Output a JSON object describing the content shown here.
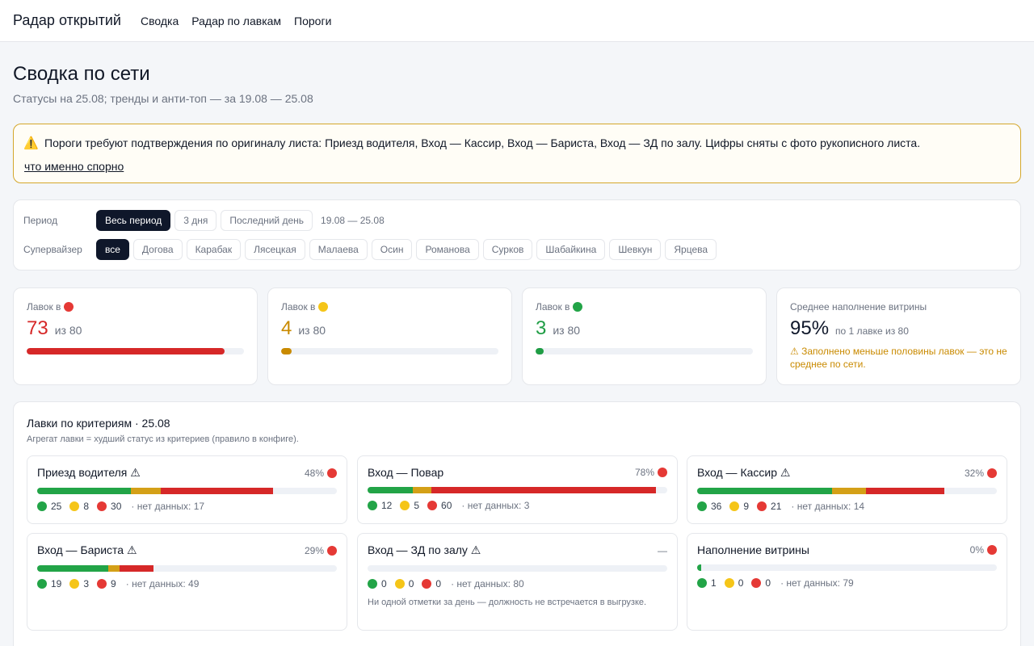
{
  "header": {
    "brand": "Радар открытий",
    "nav": [
      "Сводка",
      "Радар по лавкам",
      "Пороги"
    ]
  },
  "page": {
    "title": "Сводка по сети",
    "subtitle": "Статусы на 25.08; тренды и анти-топ — за 19.08 — 25.08"
  },
  "warning": {
    "icon": "warning-icon",
    "text": "Пороги требуют подтверждения по оригиналу листа: Приезд водителя, Вход — Кассир, Вход — Бариста, Вход — ЗД по залу. Цифры сняты с фото рукописного листа.",
    "link": "что именно спорно"
  },
  "filters": {
    "period_label": "Период",
    "period_options": [
      "Весь период",
      "3 дня",
      "Последний день"
    ],
    "period_selected": "Весь период",
    "period_range": "19.08 — 25.08",
    "supervisor_label": "Супервайзер",
    "supervisor_options": [
      "все",
      "Догова",
      "Карабак",
      "Лясецкая",
      "Малаева",
      "Осин",
      "Романова",
      "Сурков",
      "Шабайкина",
      "Шевкун",
      "Ярцева"
    ],
    "supervisor_selected": "все"
  },
  "kpis": {
    "red": {
      "label": "Лавок в",
      "value": "73",
      "of": "из 80",
      "fraction": 0.9125,
      "color": "#d62828"
    },
    "yellow": {
      "label": "Лавок в",
      "value": "4",
      "of": "из 80",
      "fraction": 0.05,
      "color": "#c98a00"
    },
    "green": {
      "label": "Лавок в",
      "value": "3",
      "of": "из 80",
      "fraction": 0.0375,
      "color": "#1f9d45"
    },
    "fill": {
      "label": "Среднее наполнение витрины",
      "value": "95%",
      "sub": "по 1 лавке из 80",
      "note": "⚠ Заполнено меньше половины лавок — это не среднее по сети."
    }
  },
  "criteria": {
    "title": "Лавки по критериям · 25.08",
    "subtitle": "Агрегат лавки = худший статус из критериев (правило в конфиге).",
    "no_data_label": "· нет данных:",
    "total": 80,
    "items": [
      {
        "name": "Приезд водителя ⚠",
        "pct": "48%",
        "status": "red",
        "green": 25,
        "yellow": 8,
        "red": 30,
        "no_data": 17
      },
      {
        "name": "Вход — Повар",
        "pct": "78%",
        "status": "red",
        "green": 12,
        "yellow": 5,
        "red": 60,
        "no_data": 3
      },
      {
        "name": "Вход — Кассир ⚠",
        "pct": "32%",
        "status": "red",
        "green": 36,
        "yellow": 9,
        "red": 21,
        "no_data": 14
      },
      {
        "name": "Вход — Бариста ⚠",
        "pct": "29%",
        "status": "red",
        "green": 19,
        "yellow": 3,
        "red": 9,
        "no_data": 49
      },
      {
        "name": "Вход — ЗД по залу ⚠",
        "pct": "—",
        "status": "none",
        "green": 0,
        "yellow": 0,
        "red": 0,
        "no_data": 80,
        "note": "Ни одной отметки за день — должность не встречается в выгрузке."
      },
      {
        "name": "Наполнение витрины",
        "pct": "0%",
        "status": "red",
        "green": 1,
        "yellow": 0,
        "red": 0,
        "no_data": 79
      }
    ]
  }
}
